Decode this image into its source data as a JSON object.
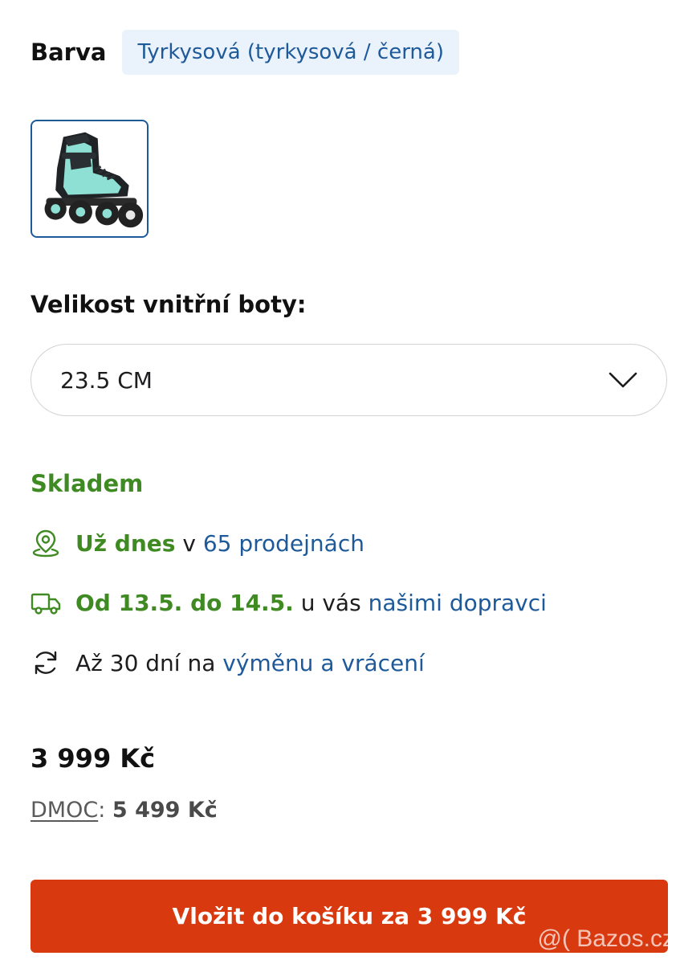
{
  "color": {
    "label": "Barva",
    "value": "Tyrkysová (tyrkysová / černá)"
  },
  "thumbnail": {
    "alt": "inline skate",
    "accent_color": "#8fe0d4"
  },
  "size": {
    "title": "Velikost vnitřní boty:",
    "selected": "23.5 CM"
  },
  "availability": {
    "status": "Skladem",
    "store": {
      "highlight": "Už dnes",
      "connector": "v",
      "link": "65 prodejnách"
    },
    "delivery": {
      "highlight": "Od 13.5. do 14.5.",
      "connector": "u vás",
      "link": "našimi dopravci"
    },
    "returns": {
      "text": "Až 30 dní na",
      "link": "výměnu a vrácení"
    }
  },
  "pricing": {
    "price": "3 999 Kč",
    "dmoc_label": "DMOC",
    "dmoc_separator": ":",
    "dmoc_price": "5 499 Kč"
  },
  "cart_button": {
    "label": "Vložit do košíku za 3 999 Kč"
  },
  "watermark": "@( Bazos.cz",
  "colors": {
    "link": "#1e5a9a",
    "green": "#3f8a22",
    "cta": "#d8390f",
    "chip_bg": "#eaf2fb"
  }
}
